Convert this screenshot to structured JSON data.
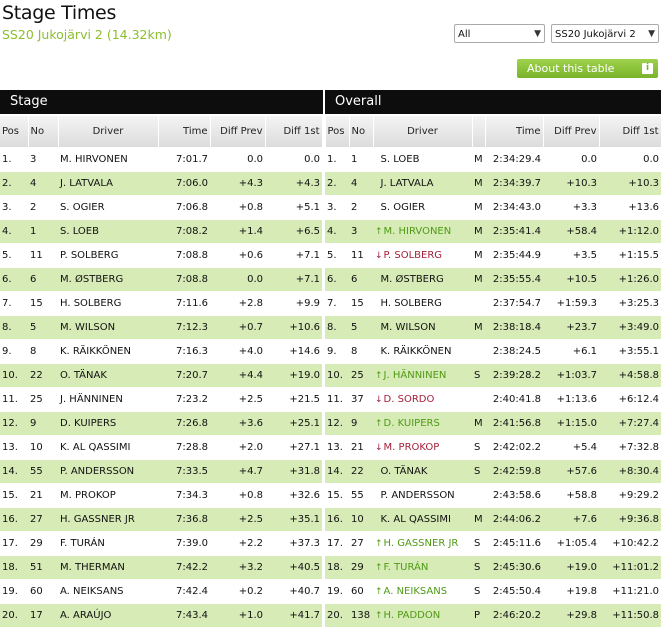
{
  "header": {
    "title": "Stage Times",
    "subtitle": "SS20 Jukojärvi 2 (14.32km)"
  },
  "controls": {
    "filter_value": "All",
    "stage_value": "SS20 Jukojärvi 2",
    "about_label": "About this table",
    "about_icon": "i"
  },
  "sections": {
    "stage": "Stage",
    "overall": "Overall"
  },
  "columns": {
    "pos": "Pos",
    "no": "No",
    "driver": "Driver",
    "time": "Time",
    "diff_prev": "Diff Prev",
    "diff_first": "Diff 1st"
  },
  "colors": {
    "accent_green": "#8cbf2f",
    "row_alt": "#d7ebb6",
    "up": "#4f9a15",
    "down": "#a3203a"
  },
  "stage_rows": [
    {
      "pos": "1.",
      "no": "3",
      "driver": "M. HIRVONEN",
      "time": "7:01.7",
      "diff_prev": "0.0",
      "diff_first": "0.0"
    },
    {
      "pos": "2.",
      "no": "4",
      "driver": "J. LATVALA",
      "time": "7:06.0",
      "diff_prev": "+4.3",
      "diff_first": "+4.3"
    },
    {
      "pos": "3.",
      "no": "2",
      "driver": "S. OGIER",
      "time": "7:06.8",
      "diff_prev": "+0.8",
      "diff_first": "+5.1"
    },
    {
      "pos": "4.",
      "no": "1",
      "driver": "S. LOEB",
      "time": "7:08.2",
      "diff_prev": "+1.4",
      "diff_first": "+6.5"
    },
    {
      "pos": "5.",
      "no": "11",
      "driver": "P. SOLBERG",
      "time": "7:08.8",
      "diff_prev": "+0.6",
      "diff_first": "+7.1"
    },
    {
      "pos": "6.",
      "no": "6",
      "driver": "M. ØSTBERG",
      "time": "7:08.8",
      "diff_prev": "0.0",
      "diff_first": "+7.1"
    },
    {
      "pos": "7.",
      "no": "15",
      "driver": "H. SOLBERG",
      "time": "7:11.6",
      "diff_prev": "+2.8",
      "diff_first": "+9.9"
    },
    {
      "pos": "8.",
      "no": "5",
      "driver": "M. WILSON",
      "time": "7:12.3",
      "diff_prev": "+0.7",
      "diff_first": "+10.6"
    },
    {
      "pos": "9.",
      "no": "8",
      "driver": "K. RÄIKKÖNEN",
      "time": "7:16.3",
      "diff_prev": "+4.0",
      "diff_first": "+14.6"
    },
    {
      "pos": "10.",
      "no": "22",
      "driver": "O. TÄNAK",
      "time": "7:20.7",
      "diff_prev": "+4.4",
      "diff_first": "+19.0"
    },
    {
      "pos": "11.",
      "no": "25",
      "driver": "J. HÄNNINEN",
      "time": "7:23.2",
      "diff_prev": "+2.5",
      "diff_first": "+21.5"
    },
    {
      "pos": "12.",
      "no": "9",
      "driver": "D. KUIPERS",
      "time": "7:26.8",
      "diff_prev": "+3.6",
      "diff_first": "+25.1"
    },
    {
      "pos": "13.",
      "no": "10",
      "driver": "K. AL QASSIMI",
      "time": "7:28.8",
      "diff_prev": "+2.0",
      "diff_first": "+27.1"
    },
    {
      "pos": "14.",
      "no": "55",
      "driver": "P. ANDERSSON",
      "time": "7:33.5",
      "diff_prev": "+4.7",
      "diff_first": "+31.8"
    },
    {
      "pos": "15.",
      "no": "21",
      "driver": "M. PROKOP",
      "time": "7:34.3",
      "diff_prev": "+0.8",
      "diff_first": "+32.6"
    },
    {
      "pos": "16.",
      "no": "27",
      "driver": "H. GASSNER JR",
      "time": "7:36.8",
      "diff_prev": "+2.5",
      "diff_first": "+35.1"
    },
    {
      "pos": "17.",
      "no": "29",
      "driver": "F. TURÁN",
      "time": "7:39.0",
      "diff_prev": "+2.2",
      "diff_first": "+37.3"
    },
    {
      "pos": "18.",
      "no": "51",
      "driver": "M. THERMAN",
      "time": "7:42.2",
      "diff_prev": "+3.2",
      "diff_first": "+40.5"
    },
    {
      "pos": "19.",
      "no": "60",
      "driver": "A. NEIKSANS",
      "time": "7:42.4",
      "diff_prev": "+0.2",
      "diff_first": "+40.7"
    },
    {
      "pos": "20.",
      "no": "17",
      "driver": "A. ARAÚJO",
      "time": "7:43.4",
      "diff_prev": "+1.0",
      "diff_first": "+41.7"
    }
  ],
  "overall_rows": [
    {
      "pos": "1.",
      "no": "1",
      "trend": "",
      "driver": "S. LOEB",
      "cls": "M",
      "time": "2:34:29.4",
      "diff_prev": "0.0",
      "diff_first": "0.0"
    },
    {
      "pos": "2.",
      "no": "4",
      "trend": "",
      "driver": "J. LATVALA",
      "cls": "M",
      "time": "2:34:39.7",
      "diff_prev": "+10.3",
      "diff_first": "+10.3"
    },
    {
      "pos": "3.",
      "no": "2",
      "trend": "",
      "driver": "S. OGIER",
      "cls": "M",
      "time": "2:34:43.0",
      "diff_prev": "+3.3",
      "diff_first": "+13.6"
    },
    {
      "pos": "4.",
      "no": "3",
      "trend": "up",
      "driver": "M. HIRVONEN",
      "cls": "M",
      "time": "2:35:41.4",
      "diff_prev": "+58.4",
      "diff_first": "+1:12.0"
    },
    {
      "pos": "5.",
      "no": "11",
      "trend": "down",
      "driver": "P. SOLBERG",
      "cls": "M",
      "time": "2:35:44.9",
      "diff_prev": "+3.5",
      "diff_first": "+1:15.5"
    },
    {
      "pos": "6.",
      "no": "6",
      "trend": "",
      "driver": "M. ØSTBERG",
      "cls": "M",
      "time": "2:35:55.4",
      "diff_prev": "+10.5",
      "diff_first": "+1:26.0"
    },
    {
      "pos": "7.",
      "no": "15",
      "trend": "",
      "driver": "H. SOLBERG",
      "cls": "",
      "time": "2:37:54.7",
      "diff_prev": "+1:59.3",
      "diff_first": "+3:25.3"
    },
    {
      "pos": "8.",
      "no": "5",
      "trend": "",
      "driver": "M. WILSON",
      "cls": "M",
      "time": "2:38:18.4",
      "diff_prev": "+23.7",
      "diff_first": "+3:49.0"
    },
    {
      "pos": "9.",
      "no": "8",
      "trend": "",
      "driver": "K. RÄIKKÖNEN",
      "cls": "",
      "time": "2:38:24.5",
      "diff_prev": "+6.1",
      "diff_first": "+3:55.1"
    },
    {
      "pos": "10.",
      "no": "25",
      "trend": "up",
      "driver": "J. HÄNNINEN",
      "cls": "S",
      "time": "2:39:28.2",
      "diff_prev": "+1:03.7",
      "diff_first": "+4:58.8"
    },
    {
      "pos": "11.",
      "no": "37",
      "trend": "down",
      "driver": "D. SORDO",
      "cls": "",
      "time": "2:40:41.8",
      "diff_prev": "+1:13.6",
      "diff_first": "+6:12.4"
    },
    {
      "pos": "12.",
      "no": "9",
      "trend": "up",
      "driver": "D. KUIPERS",
      "cls": "M",
      "time": "2:41:56.8",
      "diff_prev": "+1:15.0",
      "diff_first": "+7:27.4"
    },
    {
      "pos": "13.",
      "no": "21",
      "trend": "down",
      "driver": "M. PROKOP",
      "cls": "S",
      "time": "2:42:02.2",
      "diff_prev": "+5.4",
      "diff_first": "+7:32.8"
    },
    {
      "pos": "14.",
      "no": "22",
      "trend": "",
      "driver": "O. TÄNAK",
      "cls": "S",
      "time": "2:42:59.8",
      "diff_prev": "+57.6",
      "diff_first": "+8:30.4"
    },
    {
      "pos": "15.",
      "no": "55",
      "trend": "",
      "driver": "P. ANDERSSON",
      "cls": "",
      "time": "2:43:58.6",
      "diff_prev": "+58.8",
      "diff_first": "+9:29.2"
    },
    {
      "pos": "16.",
      "no": "10",
      "trend": "",
      "driver": "K. AL QASSIMI",
      "cls": "M",
      "time": "2:44:06.2",
      "diff_prev": "+7.6",
      "diff_first": "+9:36.8"
    },
    {
      "pos": "17.",
      "no": "27",
      "trend": "up",
      "driver": "H. GASSNER JR",
      "cls": "S",
      "time": "2:45:11.6",
      "diff_prev": "+1:05.4",
      "diff_first": "+10:42.2"
    },
    {
      "pos": "18.",
      "no": "29",
      "trend": "up",
      "driver": "F. TURÁN",
      "cls": "S",
      "time": "2:45:30.6",
      "diff_prev": "+19.0",
      "diff_first": "+11:01.2"
    },
    {
      "pos": "19.",
      "no": "60",
      "trend": "up",
      "driver": "A. NEIKSANS",
      "cls": "S",
      "time": "2:45:50.4",
      "diff_prev": "+19.8",
      "diff_first": "+11:21.0"
    },
    {
      "pos": "20.",
      "no": "138",
      "trend": "up",
      "driver": "H. PADDON",
      "cls": "P",
      "time": "2:46:20.2",
      "diff_prev": "+29.8",
      "diff_first": "+11:50.8"
    }
  ]
}
